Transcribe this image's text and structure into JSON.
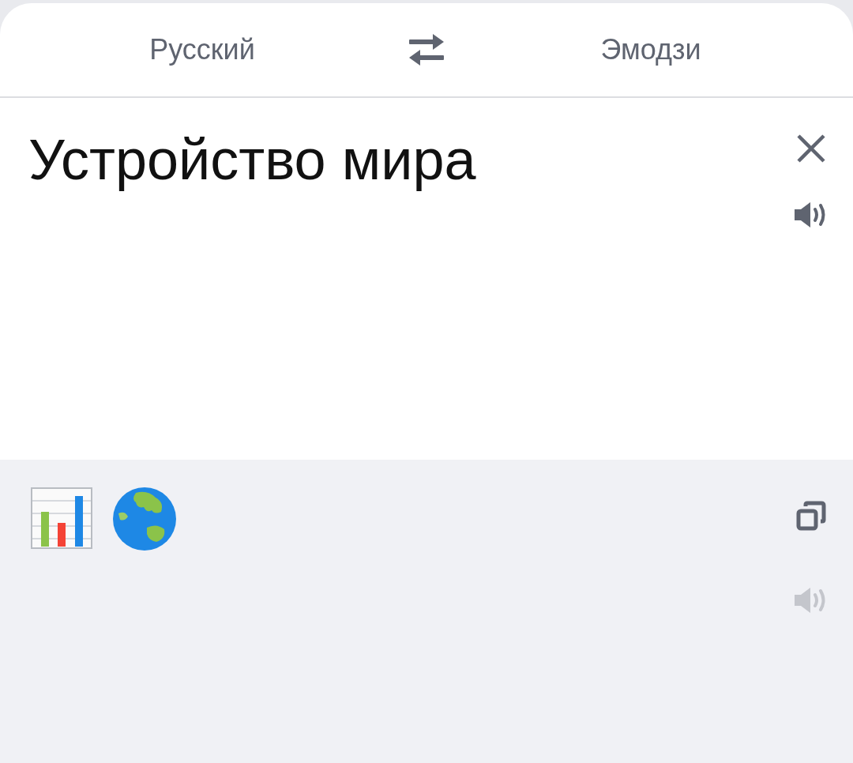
{
  "languages": {
    "source": "Русский",
    "target": "Эмодзи"
  },
  "input": {
    "value": "Устройство мира",
    "speak_disabled": false
  },
  "output": {
    "emojis": [
      {
        "kind": "bar_chart"
      },
      {
        "kind": "globe"
      }
    ],
    "speak_disabled": true
  }
}
